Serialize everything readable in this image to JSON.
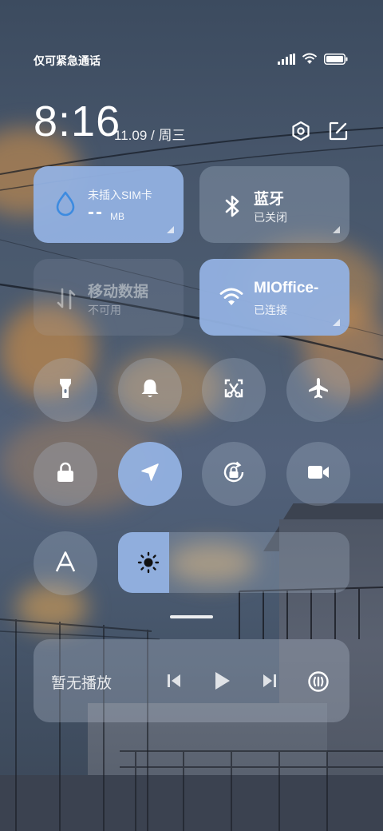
{
  "status_bar": {
    "carrier": "仅可紧急通话",
    "icons": [
      "signal-icon",
      "wifi-icon",
      "battery-icon"
    ]
  },
  "header": {
    "time": "8:16",
    "date": "11.09 / 周三",
    "icons": [
      "settings-icon",
      "edit-icon"
    ]
  },
  "tiles": {
    "data_usage": {
      "value": "--",
      "unit": "MB",
      "label": "未插入SIM卡",
      "icon": "water-drop-icon"
    },
    "bluetooth": {
      "title": "蓝牙",
      "subtitle": "已关闭",
      "icon": "bluetooth-icon"
    },
    "mobile_data": {
      "title": "移动数据",
      "subtitle": "不可用",
      "icon": "mobile-data-icon"
    },
    "wifi": {
      "title": "MIOffice-",
      "subtitle": "已连接",
      "icon": "wifi-icon"
    }
  },
  "toggles": [
    {
      "name": "flashlight",
      "icon": "flashlight-icon",
      "on": false
    },
    {
      "name": "mute",
      "icon": "bell-icon",
      "on": false
    },
    {
      "name": "screenshot",
      "icon": "screenshot-icon",
      "on": false
    },
    {
      "name": "airplane-mode",
      "icon": "airplane-icon",
      "on": false
    },
    {
      "name": "lock-screen",
      "icon": "lock-icon",
      "on": false
    },
    {
      "name": "location",
      "icon": "location-arrow-icon",
      "on": true
    },
    {
      "name": "rotation-lock",
      "icon": "rotation-lock-icon",
      "on": false
    },
    {
      "name": "screen-record",
      "icon": "video-camera-icon",
      "on": false
    },
    {
      "name": "font-size",
      "icon": "font-icon",
      "on": false
    }
  ],
  "brightness": {
    "level": 0.22,
    "icon": "sun-icon"
  },
  "media": {
    "label": "暂无播放",
    "icons": [
      "previous-icon",
      "play-icon",
      "next-icon",
      "cast-icon"
    ]
  },
  "colors": {
    "accent": "#92b1e1",
    "glass": "#b4c3d7"
  }
}
